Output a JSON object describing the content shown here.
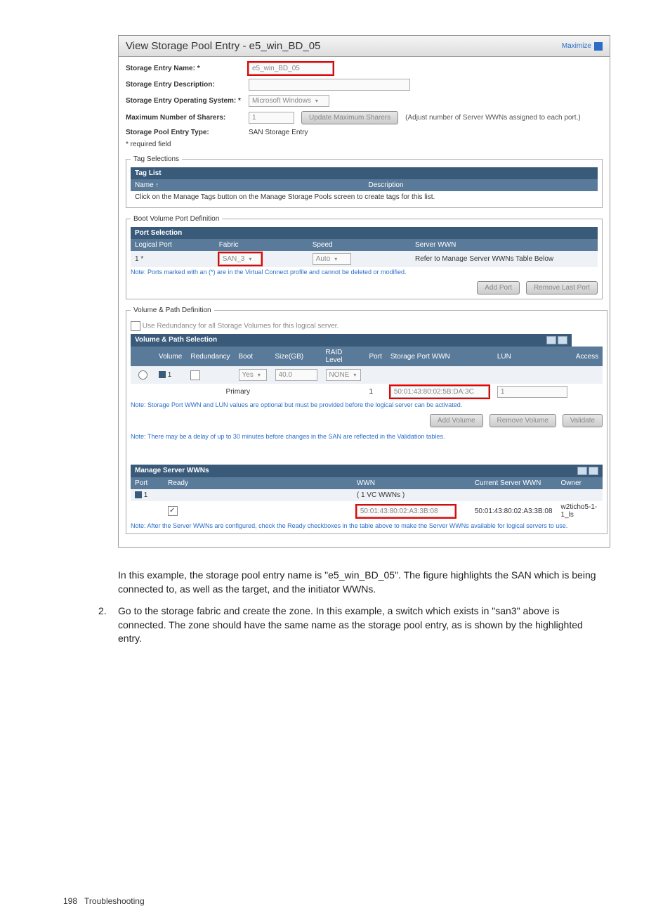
{
  "dialog": {
    "title": "View Storage Pool Entry - e5_win_BD_05",
    "maximize": "Maximize"
  },
  "fields": {
    "name_label": "Storage Entry Name: *",
    "name_value": "e5_win_BD_05",
    "desc_label": "Storage Entry Description:",
    "os_label": "Storage Entry Operating System: *",
    "os_value": "Microsoft Windows",
    "sharers_label": "Maximum Number of Sharers:",
    "sharers_value": "1",
    "update_btn": "Update Maximum Sharers",
    "sharers_hint": "(Adjust number of Server WWNs assigned to each port.)",
    "type_label": "Storage Pool Entry Type:",
    "type_value": "SAN Storage Entry",
    "required": "* required field"
  },
  "tags": {
    "legend": "Tag Selections",
    "list_title": "Tag List",
    "col_name": "Name",
    "col_desc": "Description",
    "empty": "Click on the Manage Tags button on the Manage Storage Pools screen to create tags for this list."
  },
  "boot": {
    "legend": "Boot Volume Port Definition",
    "section": "Port Selection",
    "col_port": "Logical Port",
    "col_fabric": "Fabric",
    "col_speed": "Speed",
    "col_wwn": "Server WWN",
    "row": {
      "port": "1 *",
      "fabric": "SAN_3",
      "speed": "Auto",
      "wwn": "Refer to Manage Server WWNs Table Below"
    },
    "note": "Note: Ports marked with an (*) are in the Virtual Connect profile and cannot be deleted or modified.",
    "add_btn": "Add Port",
    "remove_btn": "Remove Last Port"
  },
  "volume": {
    "legend": "Volume & Path Definition",
    "redundancy": "Use Redundancy for all Storage Volumes for this logical server.",
    "section": "Volume & Path Selection",
    "cols": {
      "volume": "Volume",
      "redundancy": "Redundancy",
      "boot": "Boot",
      "size": "Size(GB)",
      "raid": "RAID Level",
      "port": "Port",
      "spwwn": "Storage Port WWN",
      "lun": "LUN",
      "access": "Access"
    },
    "row": {
      "vol": "1",
      "boot": "Yes",
      "size": "40.0",
      "raid": "NONE",
      "primary": "Primary",
      "port": "1",
      "spwwn": "50:01:43:80:02:5B:DA:3C",
      "lun": "1"
    },
    "note1": "Note: Storage Port WWN and LUN values are optional but must be provided before the logical server can be activated.",
    "add_btn": "Add Volume",
    "remove_btn": "Remove Volume",
    "validate_btn": "Validate",
    "note2": "Note: There may be a delay of up to 30 minutes before changes in the SAN are reflected in the Validation tables."
  },
  "wwns": {
    "section": "Manage Server WWNs",
    "cols": {
      "port": "Port",
      "ready": "Ready",
      "wwn": "WWN",
      "current": "Current Server WWN",
      "owner": "Owner"
    },
    "row": {
      "port": "1",
      "count": "( 1 VC WWNs )",
      "wwn": "50:01:43:80:02:A3:3B:08",
      "current": "50:01:43:80:02:A3:3B:08",
      "owner": "w2ticho5-1-1_ls"
    },
    "note": "Note: After the Server WWNs are configured, check the Ready checkboxes in the table above to make the Server WWNs available for logical servers to use."
  },
  "body": {
    "para1": "In this example, the storage pool entry name is \"e5_win_BD_05\". The figure highlights the SAN which is being connected to, as well as the target, and the initiator WWNs.",
    "num": "2.",
    "para2": "Go to the storage fabric and create the zone. In this example, a switch which exists in \"san3\" above is connected. The zone should have the same name as the storage pool entry, as is shown by the highlighted entry."
  },
  "footer": {
    "page": "198",
    "section": "Troubleshooting"
  }
}
